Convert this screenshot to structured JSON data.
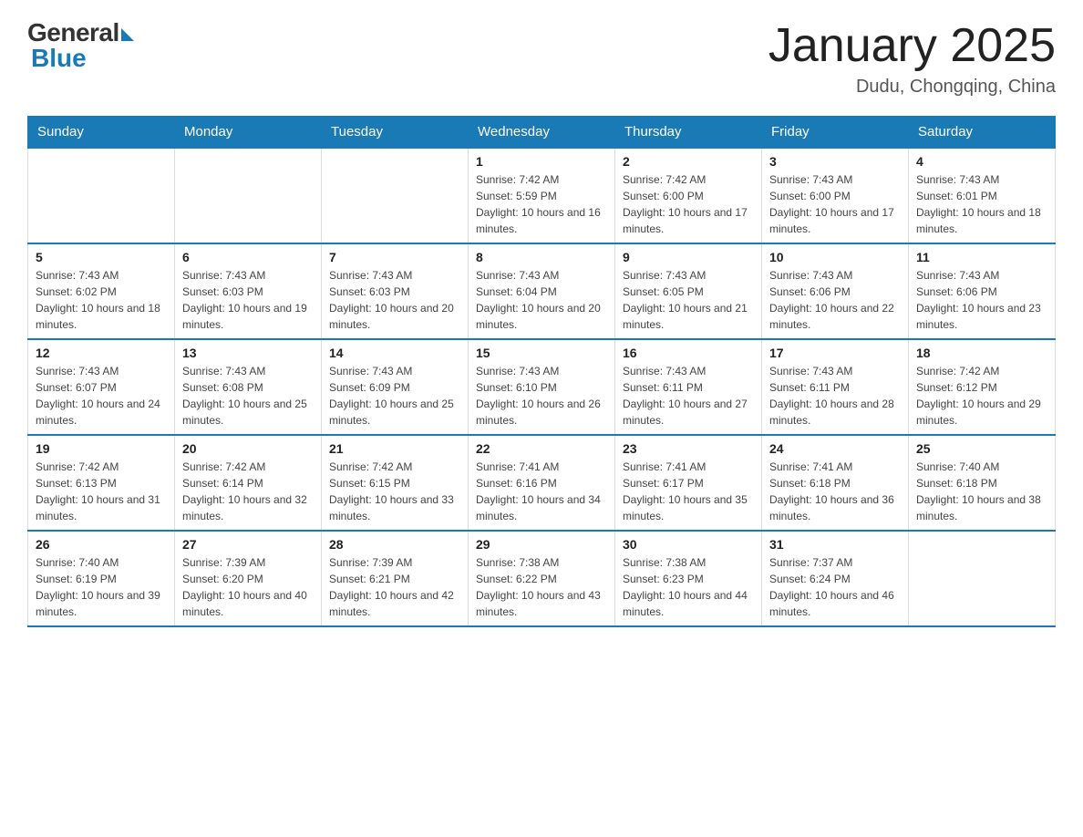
{
  "logo": {
    "general": "General",
    "blue": "Blue"
  },
  "title": "January 2025",
  "location": "Dudu, Chongqing, China",
  "days_of_week": [
    "Sunday",
    "Monday",
    "Tuesday",
    "Wednesday",
    "Thursday",
    "Friday",
    "Saturday"
  ],
  "weeks": [
    [
      null,
      null,
      null,
      {
        "date": "1",
        "sunrise": "7:42 AM",
        "sunset": "5:59 PM",
        "daylight": "10 hours and 16 minutes."
      },
      {
        "date": "2",
        "sunrise": "7:42 AM",
        "sunset": "6:00 PM",
        "daylight": "10 hours and 17 minutes."
      },
      {
        "date": "3",
        "sunrise": "7:43 AM",
        "sunset": "6:00 PM",
        "daylight": "10 hours and 17 minutes."
      },
      {
        "date": "4",
        "sunrise": "7:43 AM",
        "sunset": "6:01 PM",
        "daylight": "10 hours and 18 minutes."
      }
    ],
    [
      {
        "date": "5",
        "sunrise": "7:43 AM",
        "sunset": "6:02 PM",
        "daylight": "10 hours and 18 minutes."
      },
      {
        "date": "6",
        "sunrise": "7:43 AM",
        "sunset": "6:03 PM",
        "daylight": "10 hours and 19 minutes."
      },
      {
        "date": "7",
        "sunrise": "7:43 AM",
        "sunset": "6:03 PM",
        "daylight": "10 hours and 20 minutes."
      },
      {
        "date": "8",
        "sunrise": "7:43 AM",
        "sunset": "6:04 PM",
        "daylight": "10 hours and 20 minutes."
      },
      {
        "date": "9",
        "sunrise": "7:43 AM",
        "sunset": "6:05 PM",
        "daylight": "10 hours and 21 minutes."
      },
      {
        "date": "10",
        "sunrise": "7:43 AM",
        "sunset": "6:06 PM",
        "daylight": "10 hours and 22 minutes."
      },
      {
        "date": "11",
        "sunrise": "7:43 AM",
        "sunset": "6:06 PM",
        "daylight": "10 hours and 23 minutes."
      }
    ],
    [
      {
        "date": "12",
        "sunrise": "7:43 AM",
        "sunset": "6:07 PM",
        "daylight": "10 hours and 24 minutes."
      },
      {
        "date": "13",
        "sunrise": "7:43 AM",
        "sunset": "6:08 PM",
        "daylight": "10 hours and 25 minutes."
      },
      {
        "date": "14",
        "sunrise": "7:43 AM",
        "sunset": "6:09 PM",
        "daylight": "10 hours and 25 minutes."
      },
      {
        "date": "15",
        "sunrise": "7:43 AM",
        "sunset": "6:10 PM",
        "daylight": "10 hours and 26 minutes."
      },
      {
        "date": "16",
        "sunrise": "7:43 AM",
        "sunset": "6:11 PM",
        "daylight": "10 hours and 27 minutes."
      },
      {
        "date": "17",
        "sunrise": "7:43 AM",
        "sunset": "6:11 PM",
        "daylight": "10 hours and 28 minutes."
      },
      {
        "date": "18",
        "sunrise": "7:42 AM",
        "sunset": "6:12 PM",
        "daylight": "10 hours and 29 minutes."
      }
    ],
    [
      {
        "date": "19",
        "sunrise": "7:42 AM",
        "sunset": "6:13 PM",
        "daylight": "10 hours and 31 minutes."
      },
      {
        "date": "20",
        "sunrise": "7:42 AM",
        "sunset": "6:14 PM",
        "daylight": "10 hours and 32 minutes."
      },
      {
        "date": "21",
        "sunrise": "7:42 AM",
        "sunset": "6:15 PM",
        "daylight": "10 hours and 33 minutes."
      },
      {
        "date": "22",
        "sunrise": "7:41 AM",
        "sunset": "6:16 PM",
        "daylight": "10 hours and 34 minutes."
      },
      {
        "date": "23",
        "sunrise": "7:41 AM",
        "sunset": "6:17 PM",
        "daylight": "10 hours and 35 minutes."
      },
      {
        "date": "24",
        "sunrise": "7:41 AM",
        "sunset": "6:18 PM",
        "daylight": "10 hours and 36 minutes."
      },
      {
        "date": "25",
        "sunrise": "7:40 AM",
        "sunset": "6:18 PM",
        "daylight": "10 hours and 38 minutes."
      }
    ],
    [
      {
        "date": "26",
        "sunrise": "7:40 AM",
        "sunset": "6:19 PM",
        "daylight": "10 hours and 39 minutes."
      },
      {
        "date": "27",
        "sunrise": "7:39 AM",
        "sunset": "6:20 PM",
        "daylight": "10 hours and 40 minutes."
      },
      {
        "date": "28",
        "sunrise": "7:39 AM",
        "sunset": "6:21 PM",
        "daylight": "10 hours and 42 minutes."
      },
      {
        "date": "29",
        "sunrise": "7:38 AM",
        "sunset": "6:22 PM",
        "daylight": "10 hours and 43 minutes."
      },
      {
        "date": "30",
        "sunrise": "7:38 AM",
        "sunset": "6:23 PM",
        "daylight": "10 hours and 44 minutes."
      },
      {
        "date": "31",
        "sunrise": "7:37 AM",
        "sunset": "6:24 PM",
        "daylight": "10 hours and 46 minutes."
      },
      null
    ]
  ]
}
